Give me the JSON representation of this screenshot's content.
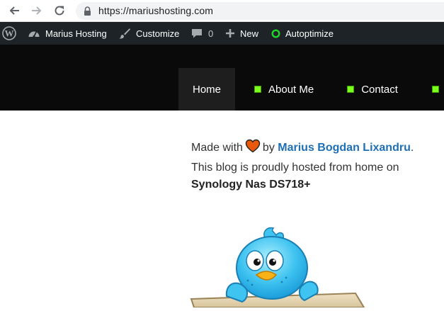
{
  "browser": {
    "url": "https://mariushosting.com",
    "icons": {
      "back": "back-arrow-icon",
      "forward": "forward-arrow-icon",
      "reload": "reload-icon",
      "lock": "lock-icon"
    }
  },
  "admin_bar": {
    "wp_logo_icon": "wordpress-logo-icon",
    "site_name": "Marius Hosting",
    "customize": "Customize",
    "comments_count": "0",
    "new": "New",
    "autoptimize": "Autoptimize",
    "colors": {
      "background": "#1d2327",
      "autoptimize_status": "#1fd42a"
    }
  },
  "nav": {
    "items": [
      {
        "label": "Home",
        "active": true
      },
      {
        "label": "About Me"
      },
      {
        "label": "Contact"
      }
    ],
    "colors": {
      "background": "#0a0a0a",
      "active_background": "#1e1e1e",
      "bullet": "#7dff1e"
    }
  },
  "content": {
    "made_with": "Made with",
    "heart_icon": "heart-icon",
    "by": "by",
    "author": "Marius Bogdan Lixandru",
    "period": ".",
    "hosted_text": "This blog is proudly hosted from home on",
    "device": "Synology Nas DS718+",
    "link_color": "#1e6fb3",
    "image": "twitter-bird-mascot"
  }
}
